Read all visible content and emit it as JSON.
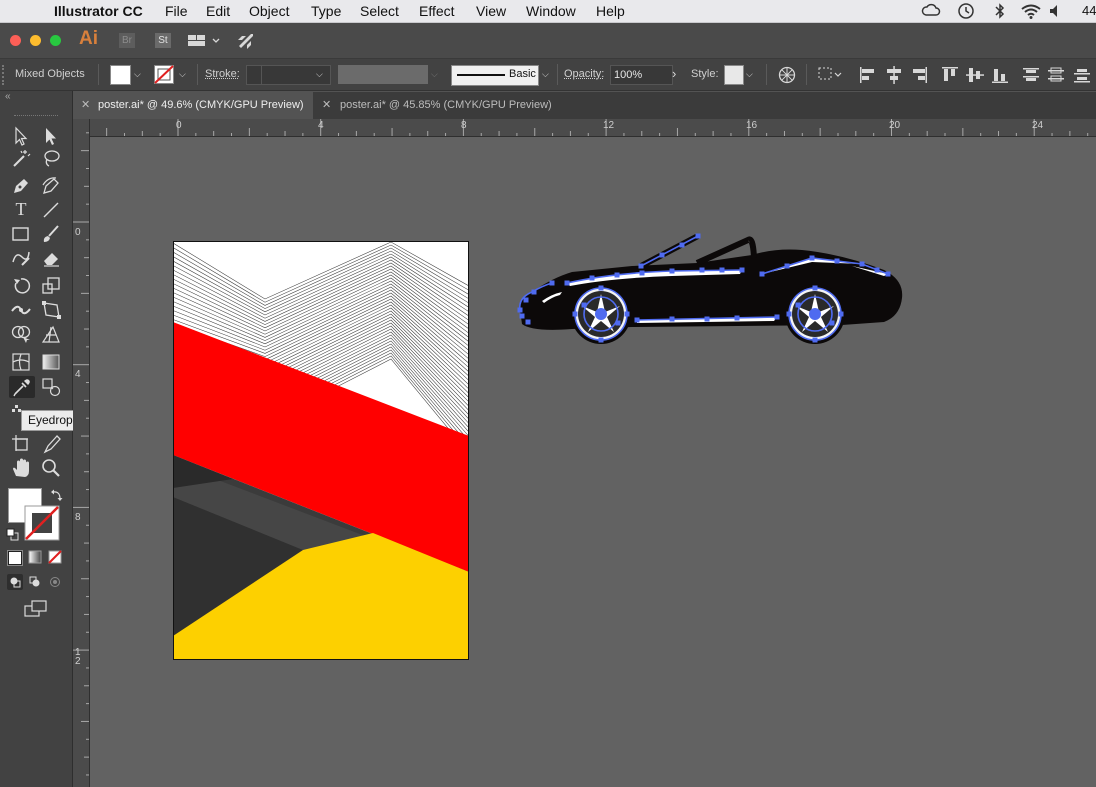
{
  "menubar": {
    "app_name": "Illustrator CC",
    "items": [
      "File",
      "Edit",
      "Object",
      "Type",
      "Select",
      "Effect",
      "View",
      "Window",
      "Help"
    ],
    "battery_text": "44"
  },
  "appbar": {
    "ai_logo": "Ai",
    "br_label": "Br",
    "st_label": "St"
  },
  "controlbar": {
    "selection_type": "Mixed Objects",
    "stroke_label": "Stroke:",
    "brush_label": "Basic",
    "opacity_label": "Opacity:",
    "opacity_value": "100%",
    "style_label": "Style:"
  },
  "tabs": [
    {
      "label": "poster.ai* @ 49.6% (CMYK/GPU Preview)",
      "active": true
    },
    {
      "label": "poster.ai* @ 45.85% (CMYK/GPU Preview)",
      "active": false
    }
  ],
  "ruler": {
    "h_labels": [
      "0",
      "4",
      "8",
      "12",
      "16",
      "20",
      "24"
    ],
    "v_labels": [
      "0",
      "4",
      "8",
      "12"
    ]
  },
  "tooltip": "Eyedropper Tool (I)",
  "colors": {
    "red": "#ff0000",
    "yellow": "#fdd000",
    "selection": "#4f6bf0",
    "car": "#0c0909"
  }
}
